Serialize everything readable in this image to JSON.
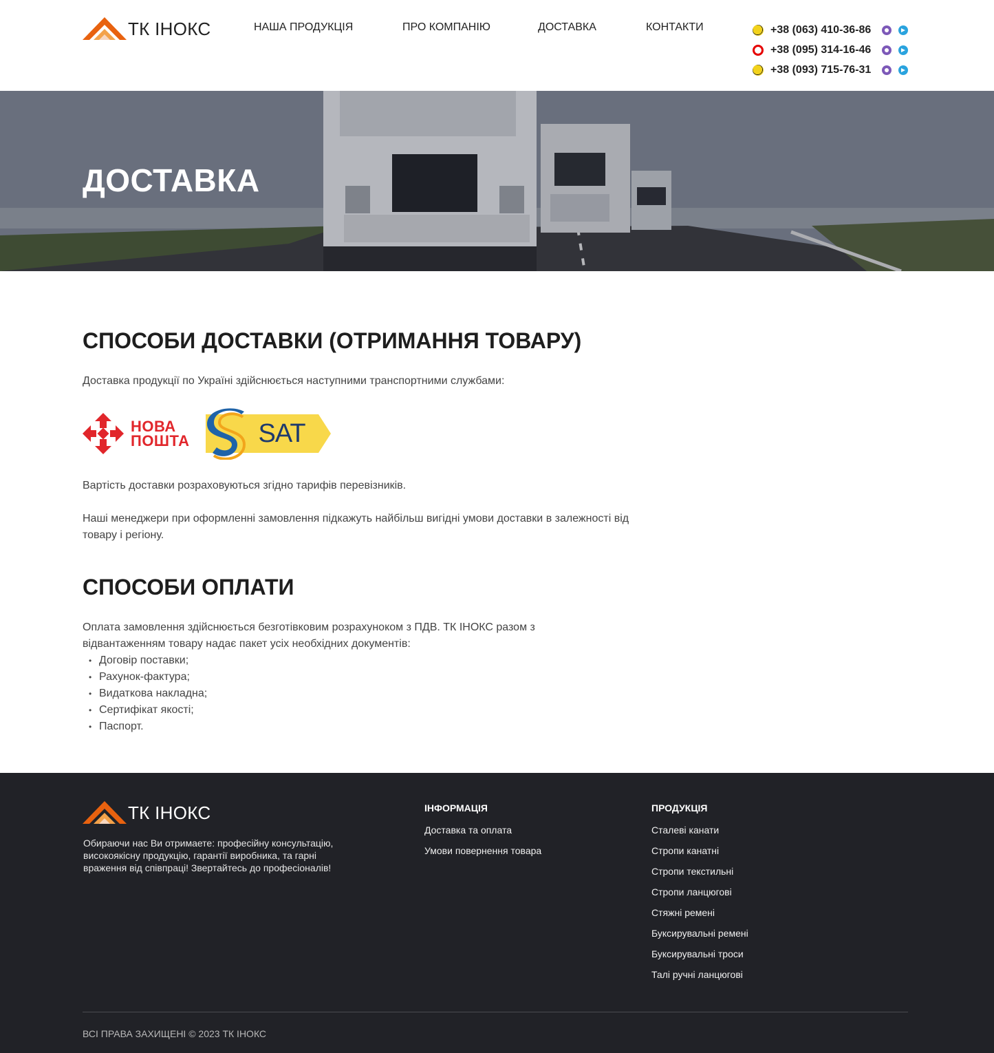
{
  "brand": {
    "name": "ТК ІНОКС",
    "accent": "#e8620f"
  },
  "nav": {
    "items": [
      {
        "label": "НАША ПРОДУКЦІЯ"
      },
      {
        "label": "ПРО КОМПАНІЮ"
      },
      {
        "label": "ДОСТАВКА"
      },
      {
        "label": "КОНТАКТИ"
      }
    ]
  },
  "contacts": {
    "phones": [
      {
        "operator": "kyivstar-icon",
        "number": "+38 (063) 410-36-86"
      },
      {
        "operator": "vodafone-icon",
        "number": "+38 (095) 314-16-46"
      },
      {
        "operator": "kyivstar-icon",
        "number": "+38 (093) 715-76-31"
      }
    ],
    "messengers": [
      "viber-icon",
      "telegram-icon"
    ]
  },
  "hero": {
    "title": "ДОСТАВКА"
  },
  "delivery": {
    "heading": "СПОСОБИ ДОСТАВКИ (ОТРИМАННЯ ТОВАРУ)",
    "intro": "Доставка продукції по Україні здійснюється наступними транспортними службами:",
    "carriers": {
      "nova_poshta_line1": "НОВА",
      "nova_poshta_line2": "ПОШТА",
      "sat": "SAT"
    },
    "cost_note": "Вартість доставки розраховуються згідно тарифів перевізників.",
    "managers_note": "Наші менеджери при оформленні замовлення підкажуть найбільш вигідні умови доставки в залежності від товару і регіону."
  },
  "payment": {
    "heading": "СПОСОБИ ОПЛАТИ",
    "intro": "Оплата замовлення здійснюється безготівковим розрахуноком з ПДВ. ТК ІНОКС разом з відвантаженням товару надає пакет усіх необхідних документів:",
    "documents": [
      "Договір поставки;",
      "Рахунок-фактура;",
      "Видаткова накладна;",
      "Сертифікат якості;",
      "Паспорт."
    ]
  },
  "footer": {
    "about": "Обираючи нас Ви отримаете: професійну консультацію, високоякісну продукцію, гарантії виробника, та гарні враження від співпраці! Звертайтесь до професіоналів!",
    "info_title": "ІНФОРМАЦІЯ",
    "info_links": [
      "Доставка та оплата",
      "Умови повернення товара"
    ],
    "products_title": "ПРОДУКЦІЯ",
    "product_links": [
      "Сталеві канати",
      "Стропи канатні",
      "Стропи текстильні",
      "Стропи ланцюгові",
      "Стяжні ремені",
      "Буксирувальні ремені",
      "Буксирувальні троси",
      "Талі ручні ланцюгові"
    ],
    "copyright": "ВСІ ПРАВА ЗАХИЩЕНІ © 2023 ТК ІНОКС"
  }
}
